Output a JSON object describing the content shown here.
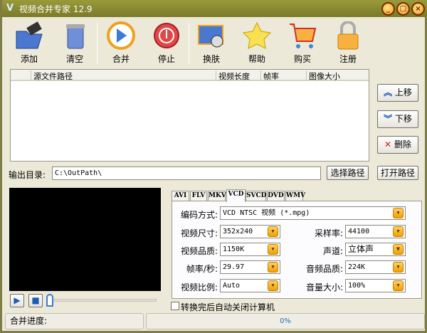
{
  "title": "视频合并专家 12.9",
  "window_controls": {
    "minimize": "_",
    "maximize": "□",
    "close": "×"
  },
  "toolbar": [
    {
      "label": "添加",
      "icon": "folder-film-icon"
    },
    {
      "label": "清空",
      "icon": "trash-icon"
    },
    {
      "label": "合并",
      "icon": "play-icon"
    },
    {
      "label": "停止",
      "icon": "stop-icon"
    },
    {
      "label": "换肤",
      "icon": "skin-icon"
    },
    {
      "label": "帮助",
      "icon": "star-help-icon"
    },
    {
      "label": "购买",
      "icon": "cart-icon"
    },
    {
      "label": "注册",
      "icon": "lock-icon"
    }
  ],
  "list": {
    "columns": [
      "源文件路径",
      "视频长度",
      "帧率",
      "图像大小"
    ],
    "rows": []
  },
  "side_buttons": {
    "up": "上移",
    "down": "下移",
    "delete": "删除"
  },
  "output": {
    "label": "输出目录:",
    "value": "C:\\OutPath\\",
    "choose": "选择路径",
    "open": "打开路径"
  },
  "tabs": [
    "AVI",
    "FLV",
    "MKV",
    "VCD",
    "SVCD",
    "DVD",
    "WMV"
  ],
  "active_tab": "VCD",
  "form": {
    "codec": {
      "label": "编码方式:",
      "value": "VCD NTSC 视频 (*.mpg)"
    },
    "size": {
      "label": "视频尺寸:",
      "value": "352x240"
    },
    "quality": {
      "label": "视频品质:",
      "value": "1150K"
    },
    "fps": {
      "label": "帧率/秒:",
      "value": "29.97"
    },
    "ratio": {
      "label": "视频比例:",
      "value": "Auto"
    },
    "samplerate": {
      "label": "采样率:",
      "value": "44100"
    },
    "channel": {
      "label": "声道:",
      "value": "立体声"
    },
    "audio_quality": {
      "label": "音频品质:",
      "value": "224K"
    },
    "volume": {
      "label": "音量大小:",
      "value": "100%"
    }
  },
  "shutdown_checkbox": {
    "label": "转换完后自动关闭计算机",
    "checked": false
  },
  "status": {
    "label": "合并进度:",
    "progress_text": "0%",
    "progress": 0
  },
  "player": {
    "position": 0
  }
}
